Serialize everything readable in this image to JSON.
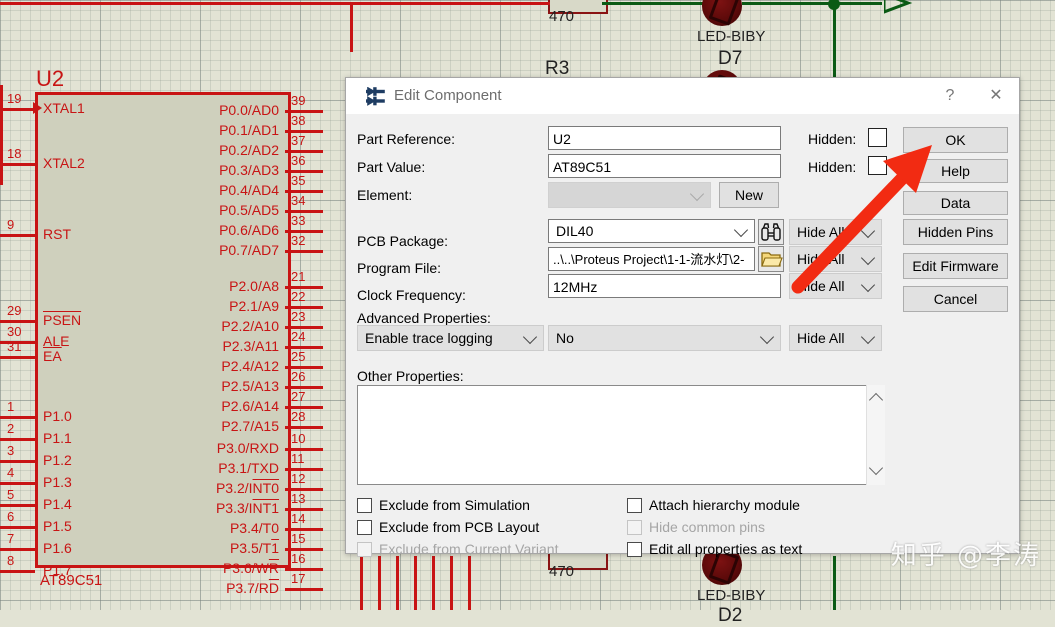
{
  "dialog": {
    "title": "Edit Component",
    "icon": "component-icon",
    "help_icon": "question-mark-icon",
    "close_icon": "close-icon",
    "fields": {
      "part_reference_label": "Part Reference:",
      "part_reference_value": "U2",
      "part_value_label": "Part Value:",
      "part_value_value": "AT89C51",
      "element_label": "Element:",
      "element_value": "",
      "new_button": "New",
      "pcb_package_label": "PCB Package:",
      "pcb_package_value": "DIL40",
      "program_file_label": "Program File:",
      "program_file_value": "..\\..\\Proteus Project\\1-1-流水灯\\2-",
      "clock_frequency_label": "Clock Frequency:",
      "clock_frequency_value": "12MHz",
      "advanced_properties_label": "Advanced Properties:",
      "advanced_property_name": "Enable trace logging",
      "advanced_property_value": "No",
      "other_properties_label": "Other Properties:",
      "other_properties_value": ""
    },
    "hidden_labels": [
      "Hidden:",
      "Hidden:"
    ],
    "hide_all": [
      "Hide All",
      "Hide All",
      "Hide All",
      "Hide All"
    ],
    "icons": {
      "pcb_package_browse": "binoculars-icon",
      "program_file_browse": "folder-icon"
    },
    "checkboxes_left": [
      {
        "label": "Exclude from Simulation",
        "checked": false,
        "disabled": false
      },
      {
        "label": "Exclude from PCB Layout",
        "checked": false,
        "disabled": false
      },
      {
        "label": "Exclude from Current Variant",
        "checked": false,
        "disabled": true
      }
    ],
    "checkboxes_right": [
      {
        "label": "Attach hierarchy module",
        "checked": false,
        "disabled": false
      },
      {
        "label": "Hide common pins",
        "checked": false,
        "disabled": true
      },
      {
        "label": "Edit all properties as text",
        "checked": false,
        "disabled": false
      }
    ],
    "buttons": [
      "OK",
      "Help",
      "Data",
      "Hidden Pins",
      "Edit Firmware",
      "Cancel"
    ]
  },
  "schematic": {
    "ic": {
      "reference": "U2",
      "part": "AT89C51",
      "left_pins": [
        {
          "num": "19",
          "label": "XTAL1"
        },
        {
          "num": "18",
          "label": "XTAL2"
        },
        {
          "num": "9",
          "label": "RST"
        },
        {
          "num": "29",
          "label": "PSEN",
          "overline": true
        },
        {
          "num": "30",
          "label": "ALE"
        },
        {
          "num": "31",
          "label": "EA",
          "overline": true
        },
        {
          "num": "1",
          "label": "P1.0"
        },
        {
          "num": "2",
          "label": "P1.1"
        },
        {
          "num": "3",
          "label": "P1.2"
        },
        {
          "num": "4",
          "label": "P1.3"
        },
        {
          "num": "5",
          "label": "P1.4"
        },
        {
          "num": "6",
          "label": "P1.5"
        },
        {
          "num": "7",
          "label": "P1.6"
        },
        {
          "num": "8",
          "label": "P1.7"
        }
      ],
      "right_pins": [
        {
          "num": "39",
          "label": "P0.0/AD0"
        },
        {
          "num": "38",
          "label": "P0.1/AD1"
        },
        {
          "num": "37",
          "label": "P0.2/AD2"
        },
        {
          "num": "36",
          "label": "P0.3/AD3"
        },
        {
          "num": "35",
          "label": "P0.4/AD4"
        },
        {
          "num": "34",
          "label": "P0.5/AD5"
        },
        {
          "num": "33",
          "label": "P0.6/AD6"
        },
        {
          "num": "32",
          "label": "P0.7/AD7"
        },
        {
          "num": "21",
          "label": "P2.0/A8"
        },
        {
          "num": "22",
          "label": "P2.1/A9"
        },
        {
          "num": "23",
          "label": "P2.2/A10"
        },
        {
          "num": "24",
          "label": "P2.3/A11"
        },
        {
          "num": "25",
          "label": "P2.4/A12"
        },
        {
          "num": "26",
          "label": "P2.5/A13"
        },
        {
          "num": "27",
          "label": "P2.6/A14"
        },
        {
          "num": "28",
          "label": "P2.7/A15"
        },
        {
          "num": "10",
          "label": "P3.0/RXD"
        },
        {
          "num": "11",
          "label": "P3.1/TXD"
        },
        {
          "num": "12",
          "label": "P3.2/INT0",
          "overline_from": 6
        },
        {
          "num": "13",
          "label": "P3.3/INT1",
          "overline_from": 6
        },
        {
          "num": "14",
          "label": "P3.4/T0"
        },
        {
          "num": "15",
          "label": "P3.5/T1",
          "overline_from": 6
        },
        {
          "num": "16",
          "label": "P3.6/WR",
          "overline_from": 6
        },
        {
          "num": "17",
          "label": "P3.7/RD",
          "overline_from": 6
        }
      ]
    },
    "components": {
      "r3_label": "R3",
      "r3_value": "470",
      "r_bottom_value": "470",
      "d7_label": "D7",
      "d7_part": "LED-BIBY",
      "d2_label": "D2",
      "d2_part": "LED-BIBY"
    }
  },
  "watermark": "知乎 @李涛"
}
